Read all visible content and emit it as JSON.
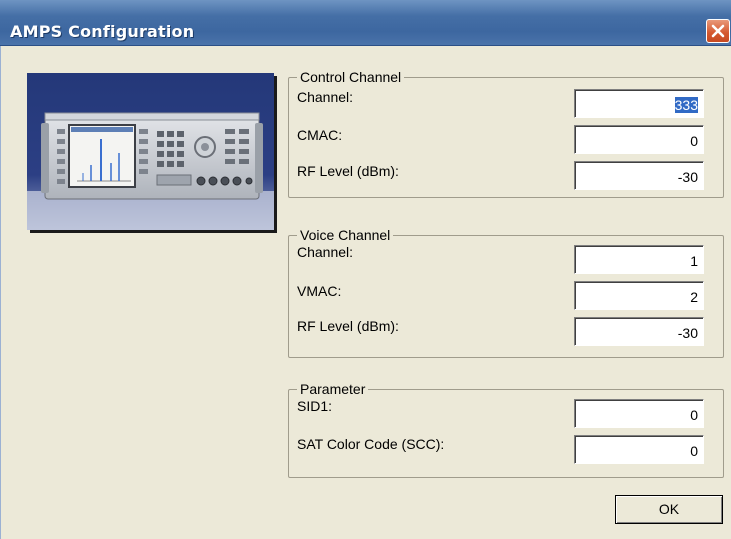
{
  "window": {
    "title": "AMPS Configuration",
    "close_icon": "close-icon"
  },
  "control_channel": {
    "title": "Control Channel",
    "channel_label": "Channel:",
    "channel_value": "333",
    "cmac_label": "CMAC:",
    "cmac_value": "0",
    "rf_level_label": "RF Level (dBm):",
    "rf_level_value": "-30"
  },
  "voice_channel": {
    "title": "Voice Channel",
    "channel_label": "Channel:",
    "channel_value": "1",
    "vmac_label": "VMAC:",
    "vmac_value": "2",
    "rf_level_label": "RF Level (dBm):",
    "rf_level_value": "-30"
  },
  "parameter": {
    "title": "Parameter",
    "sid1_label": "SID1:",
    "sid1_value": "0",
    "scc_label": "SAT Color Code (SCC):",
    "scc_value": "0"
  },
  "buttons": {
    "ok_label": "OK"
  },
  "colors": {
    "titlebar": "#456fa6",
    "dialog_bg": "#ece9d8",
    "close_button": "#d4582e",
    "selection": "#316ac5"
  }
}
